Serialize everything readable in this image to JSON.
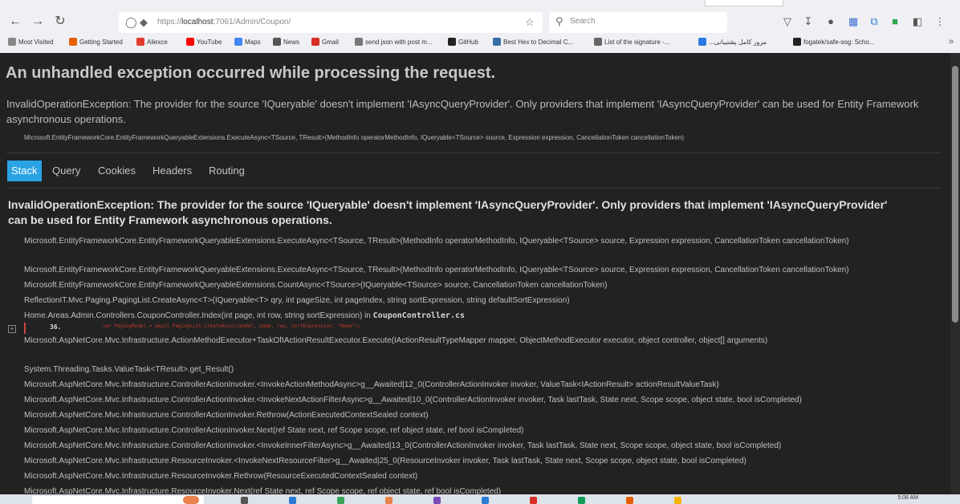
{
  "browser": {
    "url_prefix": "https://",
    "url_host": "localhost",
    "url_rest": ":7061/Admin/Coupon/",
    "search_placeholder": "Search",
    "bookmarks": [
      {
        "label": "Most Visited",
        "color": "#888888"
      },
      {
        "label": "Getting Started",
        "color": "#e66000"
      },
      {
        "label": "Aliexce",
        "color": "#e43d30"
      },
      {
        "label": "YouTube",
        "color": "#ff0000"
      },
      {
        "label": "Maps",
        "color": "#4285f4"
      },
      {
        "label": "News",
        "color": "#555555"
      },
      {
        "label": "Gmail",
        "color": "#d93025"
      },
      {
        "label": "send json with post m...",
        "color": "#777777"
      },
      {
        "label": "GitHub",
        "color": "#222222"
      },
      {
        "label": "Best Hex to Decimal C...",
        "color": "#3a6ea5"
      },
      {
        "label": "List of the signature -...",
        "color": "#666666"
      },
      {
        "label": "...مرور کامل پشتیبانی",
        "color": "#2c7be5"
      },
      {
        "label": "fogatek/safe-sog: Scho...",
        "color": "#222222"
      }
    ]
  },
  "page": {
    "title": "An unhandled exception occurred while processing the request.",
    "exception_message": "InvalidOperationException: The provider for the source 'IQueryable' doesn't implement 'IAsyncQueryProvider'. Only providers that implement 'IAsyncQueryProvider' can be used for Entity Framework asynchronous operations.",
    "exception_location": "Microsoft.EntityFrameworkCore.EntityFrameworkQueryableExtensions.ExecuteAsync<TSource, TResult>(MethodInfo operatorMethodInfo, IQueryable<TSource> source, Expression expression, CancellationToken cancellationToken)",
    "tabs": [
      "Stack",
      "Query",
      "Cookies",
      "Headers",
      "Routing"
    ],
    "active_tab": "Stack",
    "stack_title": "InvalidOperationException: The provider for the source 'IQueryable' doesn't implement 'IAsyncQueryProvider'. Only providers that implement 'IAsyncQueryProvider' can be used for Entity Framework asynchronous operations.",
    "frames": [
      "Microsoft.EntityFrameworkCore.EntityFrameworkQueryableExtensions.ExecuteAsync<TSource, TResult>(MethodInfo operatorMethodInfo, IQueryable<TSource> source, Expression expression, CancellationToken cancellationToken)",
      "Microsoft.EntityFrameworkCore.EntityFrameworkQueryableExtensions.ExecuteAsync<TSource, TResult>(MethodInfo operatorMethodInfo, IQueryable<TSource> source, Expression expression, CancellationToken cancellationToken)",
      "Microsoft.EntityFrameworkCore.EntityFrameworkQueryableExtensions.CountAsync<TSource>(IQueryable<TSource> source, CancellationToken cancellationToken)",
      "ReflectionIT.Mvc.Paging.PagingList.CreateAsync<T>(IQueryable<T> qry, int pageSize, int pageIndex, string sortExpression, string defaultSortExpression)"
    ],
    "controller_frame": "Home.Areas.Admin.Controllers.CouponController.Index(int page, int row, string sortExpression) in ",
    "controller_file": "CouponController.cs",
    "code_line_number": "36.",
    "code_line": "var PagingModel = await PagingList.CreateAsync(model, page, row, sortExpression, \"Name\");",
    "frames_after": [
      "Microsoft.AspNetCore.Mvc.Infrastructure.ActionMethodExecutor+TaskOfIActionResultExecutor.Execute(IActionResultTypeMapper mapper, ObjectMethodExecutor executor, object controller, object[] arguments)",
      "System.Threading.Tasks.ValueTask<TResult>.get_Result()",
      "Microsoft.AspNetCore.Mvc.Infrastructure.ControllerActionInvoker.<InvokeActionMethodAsync>g__Awaited|12_0(ControllerActionInvoker invoker, ValueTask<IActionResult> actionResultValueTask)",
      "Microsoft.AspNetCore.Mvc.Infrastructure.ControllerActionInvoker.<InvokeNextActionFilterAsync>g__Awaited|10_0(ControllerActionInvoker invoker, Task lastTask, State next, Scope scope, object state, bool isCompleted)",
      "Microsoft.AspNetCore.Mvc.Infrastructure.ControllerActionInvoker.Rethrow(ActionExecutedContextSealed context)",
      "Microsoft.AspNetCore.Mvc.Infrastructure.ControllerActionInvoker.Next(ref State next, ref Scope scope, ref object state, ref bool isCompleted)",
      "Microsoft.AspNetCore.Mvc.Infrastructure.ControllerActionInvoker.<InvokeInnerFilterAsync>g__Awaited|13_0(ControllerActionInvoker invoker, Task lastTask, State next, Scope scope, object state, bool isCompleted)",
      "Microsoft.AspNetCore.Mvc.Infrastructure.ResourceInvoker.<InvokeNextResourceFilter>g__Awaited|25_0(ResourceInvoker invoker, Task lastTask, State next, Scope scope, object state, bool isCompleted)",
      "Microsoft.AspNetCore.Mvc.Infrastructure.ResourceInvoker.Rethrow(ResourceExecutedContextSealed context)",
      "Microsoft.AspNetCore.Mvc.Infrastructure.ResourceInvoker.Next(ref State next, ref Scope scope, ref object state, ref bool isCompleted)"
    ]
  },
  "taskbar": {
    "time": "5:08 AM"
  },
  "colors": {
    "accent": "#2aa3e4",
    "page_bg": "#222222",
    "code_error": "#c0392b"
  }
}
